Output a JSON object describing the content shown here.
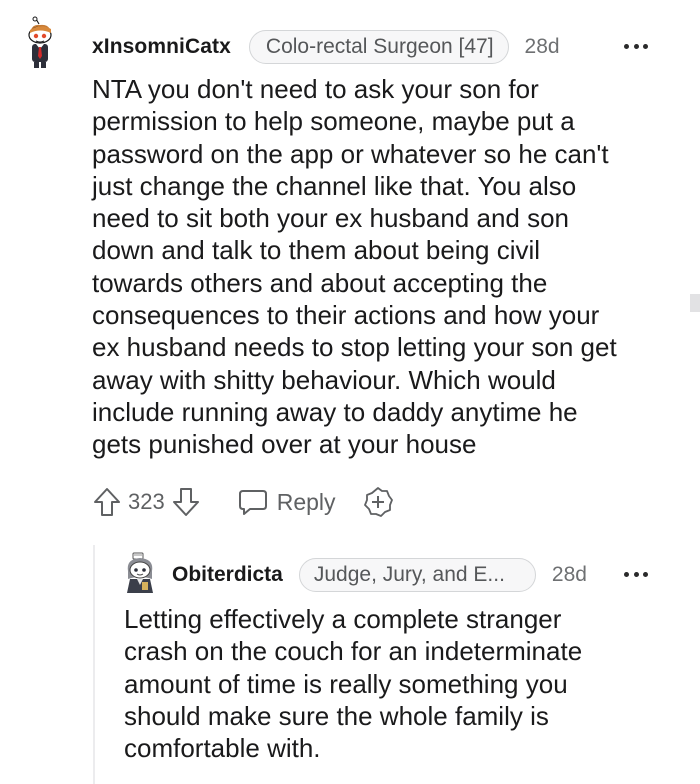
{
  "comment": {
    "username": "xInsomniCatx",
    "flair": "Colo-rectal Surgeon [47]",
    "age": "28d",
    "body_lines": [
      "NTA you don't need to ask your son for",
      "permission to help someone, maybe put a",
      "password on the app or whatever so he can't",
      "just change the channel like that. You also",
      "need to sit both your ex husband and son",
      "down and talk to them about being civil",
      "towards others and about accepting the",
      "consequences to their actions and how your",
      "ex husband needs to stop letting your son get",
      "away with shitty behaviour. Which would",
      "include running away to daddy anytime he",
      "gets punished over at your house"
    ],
    "actions": {
      "vote_count": "323",
      "reply_label": "Reply"
    }
  },
  "reply": {
    "username": "Obiterdicta",
    "flair": "Judge, Jury, and E...",
    "age": "28d",
    "body_lines": [
      "Letting effectively a complete stranger",
      "crash on the couch for an indeterminate",
      "amount of time is really something you",
      "should make sure the whole family is",
      "comfortable with."
    ]
  },
  "icons": {
    "upvote": "upvote-arrow-icon",
    "downvote": "downvote-arrow-icon",
    "reply": "speech-bubble-icon",
    "award": "plus-badge-icon",
    "more": "three-dots-icon"
  },
  "colors": {
    "text": "#1a1a1b",
    "meta": "#6e7072",
    "flair_border": "#d4d6d8",
    "action": "#5f6163"
  }
}
